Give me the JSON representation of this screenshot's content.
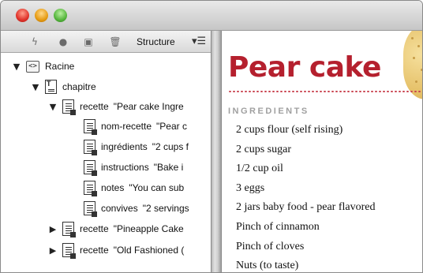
{
  "toolbar": {
    "icons": [
      "lightning-icon",
      "record-icon",
      "panel-icon",
      "trash-icon"
    ],
    "structure_label": "Structure",
    "menu_glyph": "▾☰"
  },
  "tree": {
    "root": {
      "name": "Racine",
      "tag": "<>"
    },
    "chapitre": {
      "name": "chapitre"
    },
    "recette1": {
      "name": "recette",
      "value": "\"Pear cake Ingre"
    },
    "children": [
      {
        "name": "nom-recette",
        "value": "\"Pear c"
      },
      {
        "name": "ingrédients",
        "value": "\"2 cups f"
      },
      {
        "name": "instructions",
        "value": "\"Bake i"
      },
      {
        "name": "notes",
        "value": "\"You can sub"
      },
      {
        "name": "convives",
        "value": "\"2 servings"
      }
    ],
    "recette2": {
      "name": "recette",
      "value": "\"Pineapple Cake"
    },
    "recette3": {
      "name": "recette",
      "value": "\"Old Fashioned ("
    }
  },
  "document": {
    "title": "Pear cake",
    "ingredients_heading": "INGREDIENTS",
    "ingredients": [
      "2 cups flour (self rising)",
      "2 cups sugar",
      "1/2 cup oil",
      "3 eggs",
      "2 jars baby food - pear flavored",
      "Pinch of cinnamon",
      "Pinch of cloves",
      "Nuts (to taste)"
    ]
  },
  "colors": {
    "title_red": "#b5202e",
    "heading_gray": "#a0a0a0"
  }
}
